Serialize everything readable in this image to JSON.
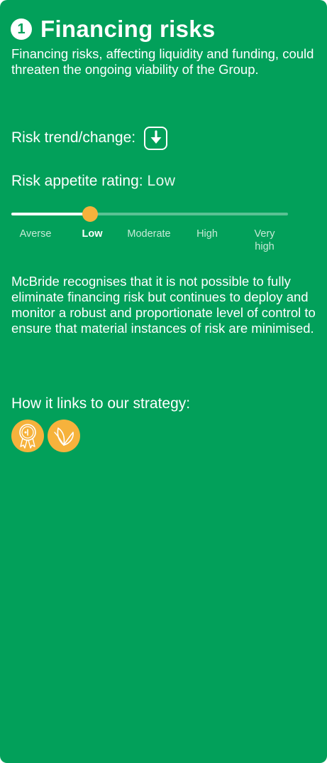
{
  "card": {
    "number": "1",
    "title": "Financing risks",
    "intro": "Financing risks, affecting liquidity and funding, could threaten the ongoing viability of the Group.",
    "risk_trend": {
      "label": "Risk trend/change:",
      "icon": "arrow-down-icon"
    },
    "risk_appetite": {
      "label": "Risk appetite rating:",
      "value": "Low",
      "scale": [
        "Averse",
        "Low",
        "Moderate",
        "High",
        "Very high"
      ],
      "selected_index": 1,
      "level_fraction": 0.285
    },
    "body": "McBride recognises that it is not possible to fully eliminate financing risk but continues to deploy and monitor a robust and proportionate level of control to ensure that material instances of risk are minimised.",
    "strategy": {
      "label": "How it links to our strategy:",
      "icons": [
        "award-rosette-icon",
        "leaf-icon"
      ]
    }
  },
  "colors": {
    "background": "#02a05a",
    "text": "#ffffff",
    "accent": "#f6b23c"
  }
}
